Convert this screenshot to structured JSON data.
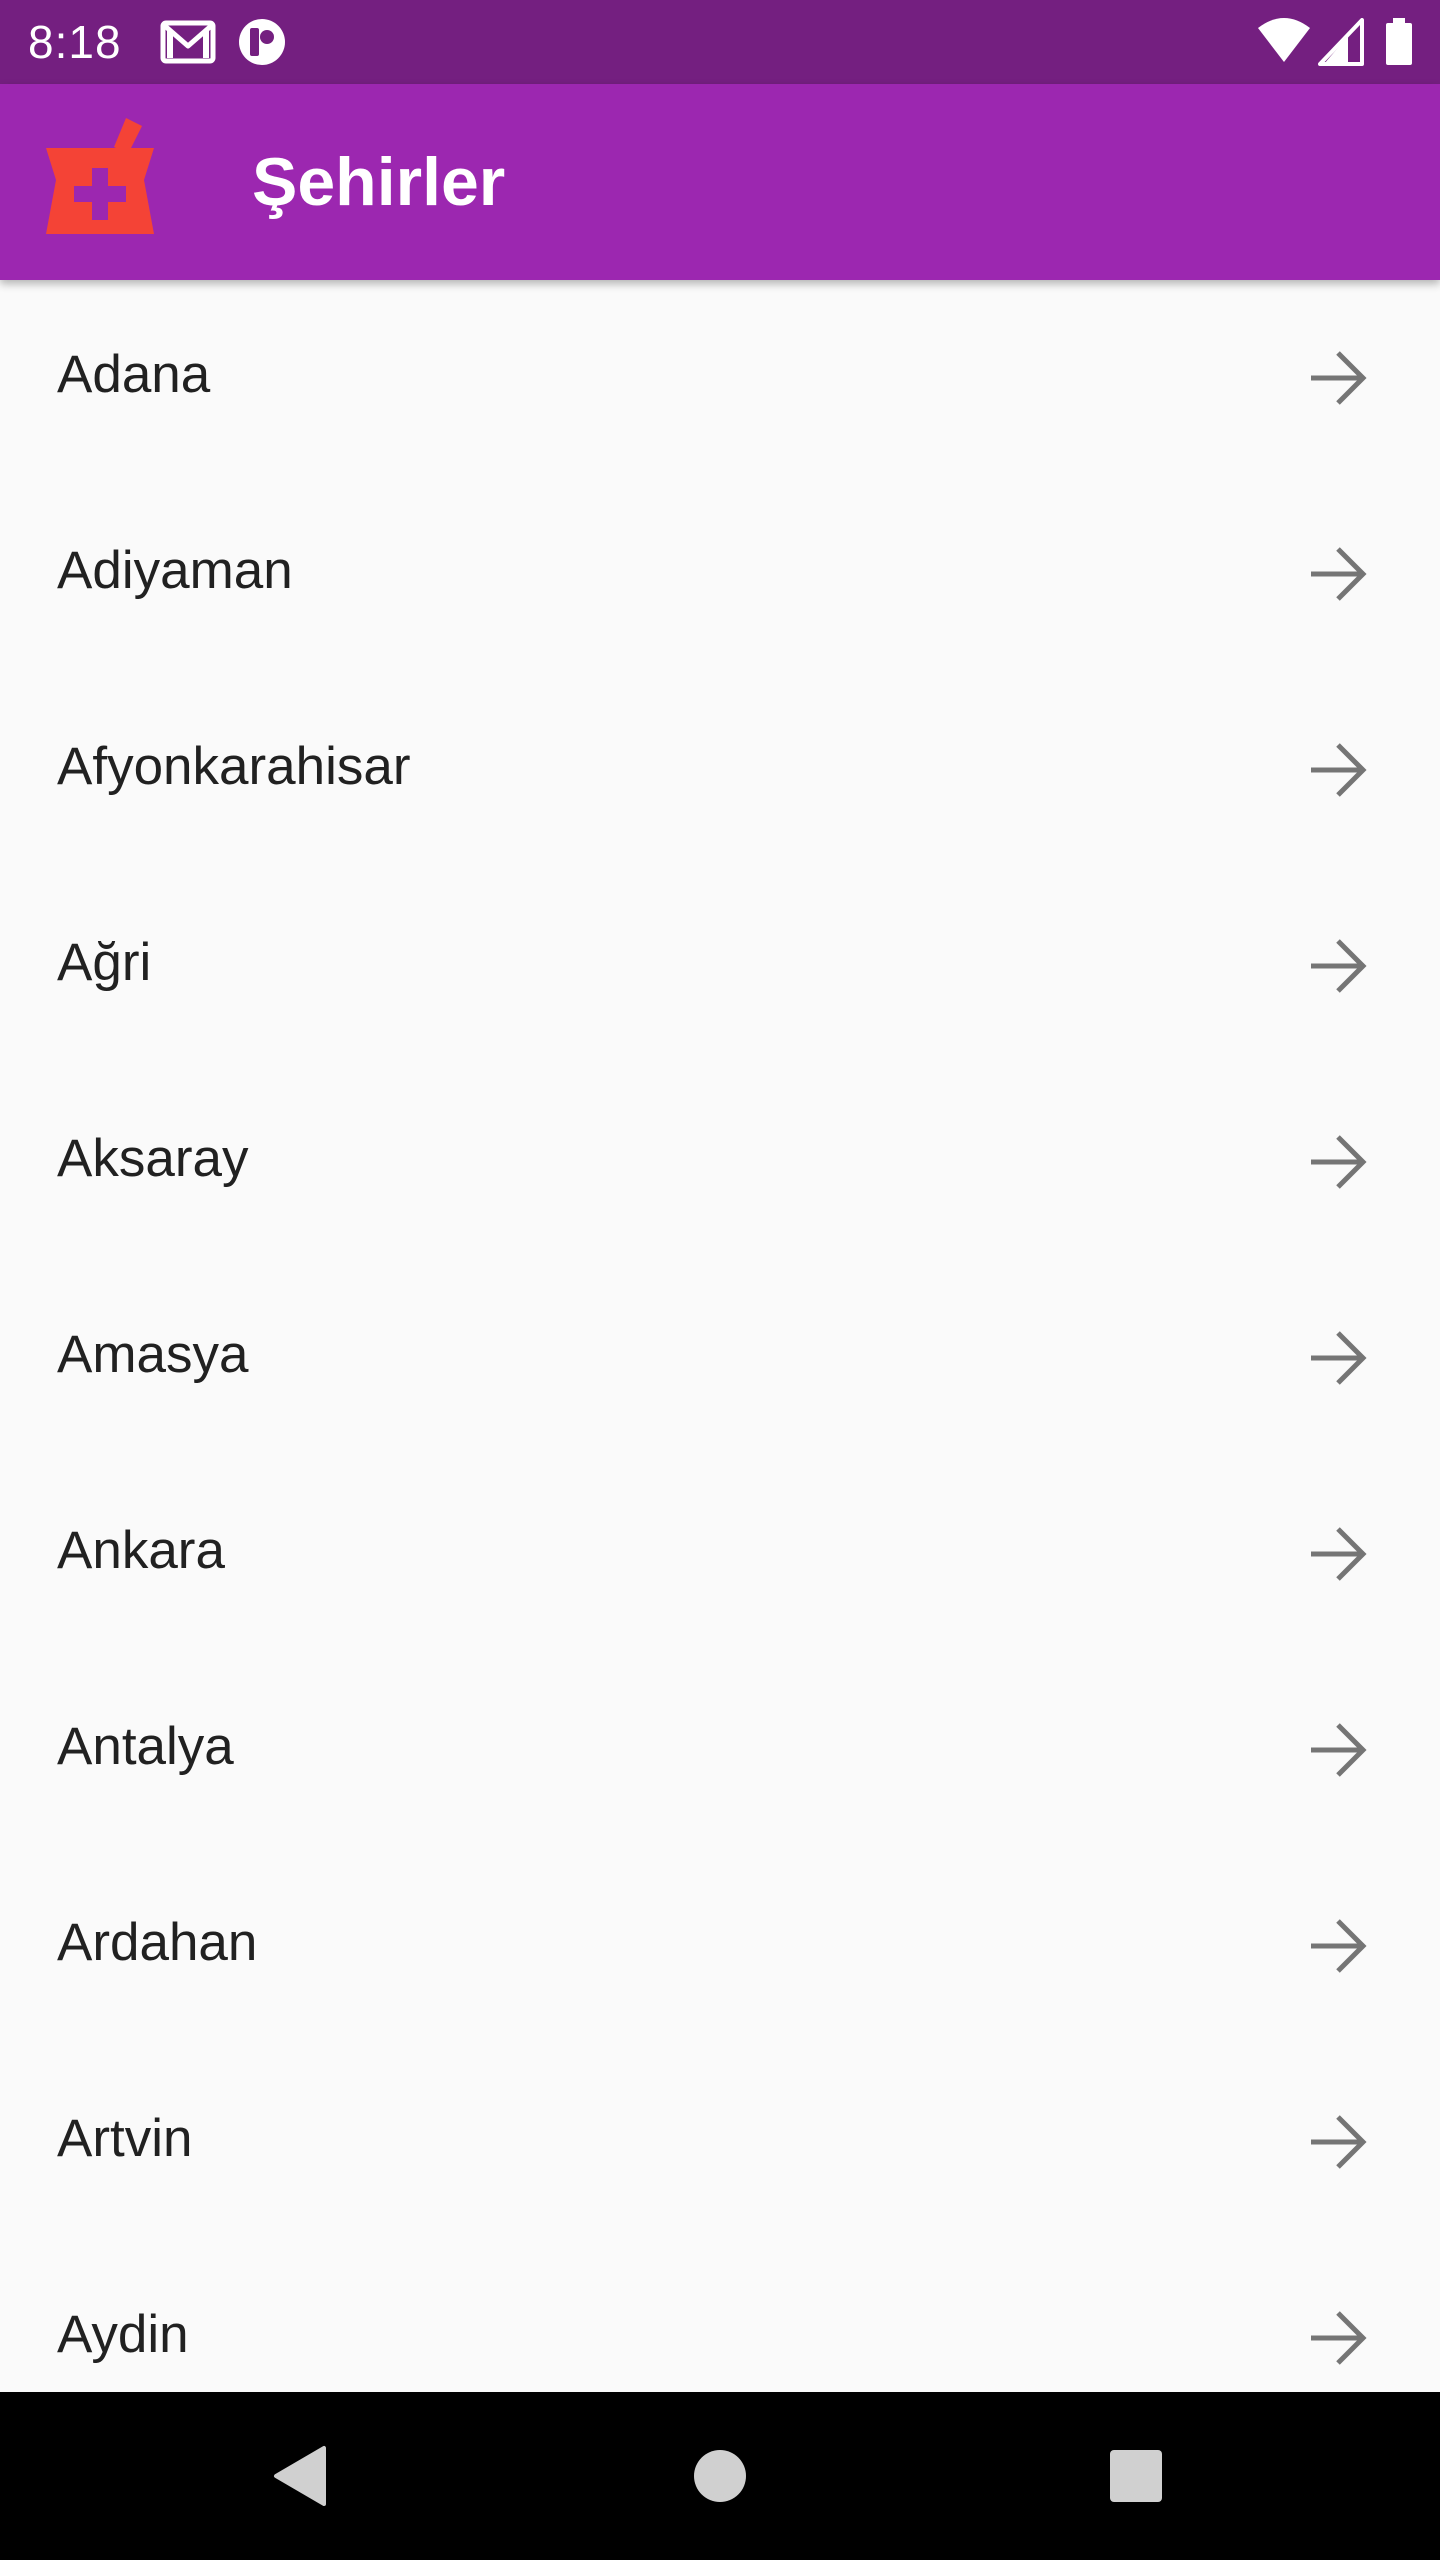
{
  "status_bar": {
    "time": "8:18",
    "background": "#741f80",
    "icons": [
      "gmail-icon",
      "app-notification-icon",
      "wifi-icon",
      "cell-signal-icon",
      "battery-icon"
    ]
  },
  "app_bar": {
    "title": "Şehirler",
    "background": "#9c27b0",
    "logo": "pharmacy-mortar-icon",
    "logo_color": "#f44336"
  },
  "cities": [
    {
      "name": "Adana",
      "icon": "arrow-right-icon"
    },
    {
      "name": "Adiyaman",
      "icon": "arrow-right-icon"
    },
    {
      "name": "Afyonkarahisar",
      "icon": "arrow-right-icon"
    },
    {
      "name": "Ağri",
      "icon": "arrow-right-icon"
    },
    {
      "name": "Aksaray",
      "icon": "arrow-right-icon"
    },
    {
      "name": "Amasya",
      "icon": "arrow-right-icon"
    },
    {
      "name": "Ankara",
      "icon": "arrow-right-icon"
    },
    {
      "name": "Antalya",
      "icon": "arrow-right-icon"
    },
    {
      "name": "Ardahan",
      "icon": "arrow-right-icon"
    },
    {
      "name": "Artvin",
      "icon": "arrow-right-icon"
    },
    {
      "name": "Aydin",
      "icon": "arrow-right-icon"
    }
  ],
  "nav_bar": {
    "buttons": [
      "back-icon",
      "home-icon",
      "recents-icon"
    ]
  }
}
